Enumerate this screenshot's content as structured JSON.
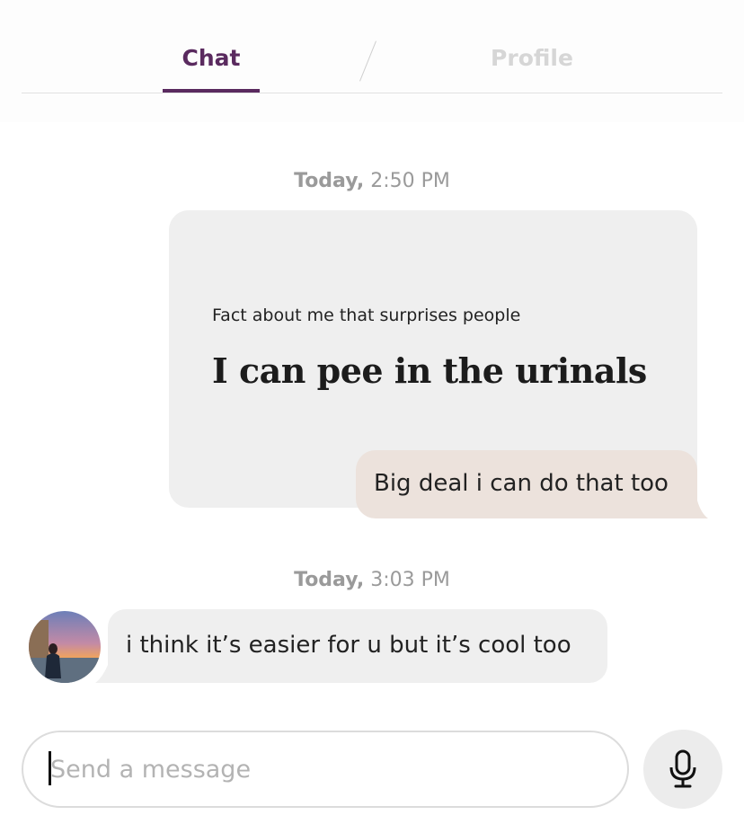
{
  "tabs": {
    "chat_label": "Chat",
    "profile_label": "Profile"
  },
  "messages": [
    {
      "timestamp_day": "Today,",
      "timestamp_time": "2:50 PM",
      "prompt_question": "Fact about me that surprises people",
      "prompt_answer": "I can pee in the urinals",
      "reply_text": "Big deal i can do that too"
    },
    {
      "timestamp_day": "Today,",
      "timestamp_time": "3:03 PM",
      "text": "i think it’s easier for u but it’s cool too"
    }
  ],
  "composer": {
    "placeholder": "Send a message"
  },
  "colors": {
    "accent": "#5a2a5f",
    "outgoing_bubble": "#ece2dc",
    "incoming_bubble": "#efefef"
  },
  "icons": {
    "mic": "microphone-icon"
  }
}
